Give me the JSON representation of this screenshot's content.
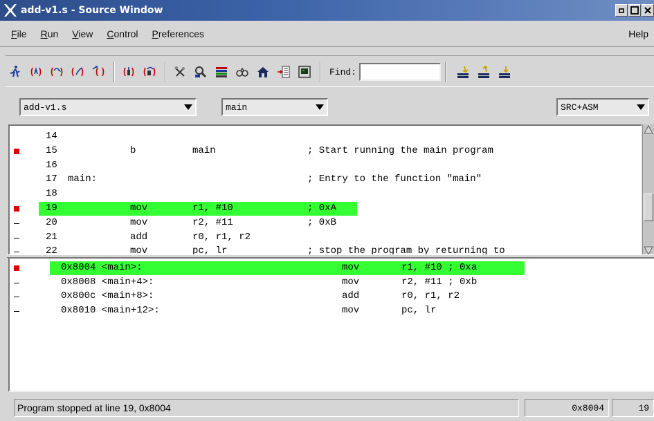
{
  "window": {
    "title": "add-v1.s - Source Window",
    "logo_icon": "x-window-logo-icon",
    "buttons": [
      "minimize-icon",
      "maximize-icon",
      "close-icon"
    ]
  },
  "menu": {
    "items": [
      {
        "label": "File",
        "underline": "F",
        "rest": "ile"
      },
      {
        "label": "Run",
        "underline": "R",
        "rest": "un"
      },
      {
        "label": "View",
        "underline": "V",
        "rest": "iew"
      },
      {
        "label": "Control",
        "underline": "C",
        "rest": "ontrol"
      },
      {
        "label": "Preferences",
        "underline": "P",
        "rest": "references"
      }
    ],
    "help": {
      "label": "Help",
      "underline": "H",
      "rest": "elp"
    }
  },
  "toolbar": {
    "icons": [
      "run-icon",
      "step-icon",
      "next-icon",
      "finish-icon",
      "continue-icon",
      "step-asm-icon",
      "next-asm-icon",
      "registers-icon",
      "memory-icon",
      "stack-icon",
      "watch-icon",
      "locals-icon",
      "breakpoints-icon",
      "console-icon",
      "up-frame-icon",
      "down-frame-icon",
      "bottom-frame-icon"
    ],
    "find_label": "Find:",
    "find_value": ""
  },
  "combos": {
    "file": "add-v1.s",
    "function": "main",
    "mode": "SRC+ASM"
  },
  "source": {
    "lines": [
      {
        "num": "14",
        "label": "",
        "op": "",
        "args": "",
        "comment": "",
        "marker": "none",
        "current": false
      },
      {
        "num": "15",
        "label": "",
        "op": "b",
        "args": "main",
        "comment": "; Start running the main program",
        "marker": "breakpoint",
        "current": false
      },
      {
        "num": "16",
        "label": "",
        "op": "",
        "args": "",
        "comment": "",
        "marker": "none",
        "current": false
      },
      {
        "num": "17",
        "label": "main:",
        "op": "",
        "args": "",
        "comment": "; Entry to the function \"main\"",
        "marker": "none",
        "current": false
      },
      {
        "num": "18",
        "label": "",
        "op": "",
        "args": "",
        "comment": "",
        "marker": "none",
        "current": false
      },
      {
        "num": "19",
        "label": "",
        "op": "mov",
        "args": "r1, #10",
        "comment": "; 0xA",
        "marker": "breakpoint",
        "current": true
      },
      {
        "num": "20",
        "label": "",
        "op": "mov",
        "args": "r2, #11",
        "comment": "; 0xB",
        "marker": "line",
        "current": false
      },
      {
        "num": "21",
        "label": "",
        "op": "add",
        "args": "r0, r1, r2",
        "comment": "",
        "marker": "line",
        "current": false
      },
      {
        "num": "22",
        "label": "",
        "op": "mov",
        "args": "pc, lr",
        "comment": "; stop the program by returning to",
        "marker": "line",
        "current": false
      }
    ]
  },
  "assembly": {
    "lines": [
      {
        "addr": "0x8004 <main>:",
        "op": "mov",
        "args": "r1, #10 ; 0xa",
        "marker": "breakpoint",
        "current": true
      },
      {
        "addr": "0x8008 <main+4>:",
        "op": "mov",
        "args": "r2, #11 ; 0xb",
        "marker": "line",
        "current": false
      },
      {
        "addr": "0x800c <main+8>:",
        "op": "add",
        "args": "r0, r1, r2",
        "marker": "line",
        "current": false
      },
      {
        "addr": "0x8010 <main+12>:",
        "op": "mov",
        "args": "pc, lr",
        "marker": "line",
        "current": false
      }
    ]
  },
  "status": {
    "message": "Program stopped at line 19, 0x8004",
    "address": "0x8004",
    "line": "19"
  },
  "colors": {
    "current_line": "#33ff33",
    "breakpoint": "#e00000",
    "title_bar": "#3b62a8"
  }
}
